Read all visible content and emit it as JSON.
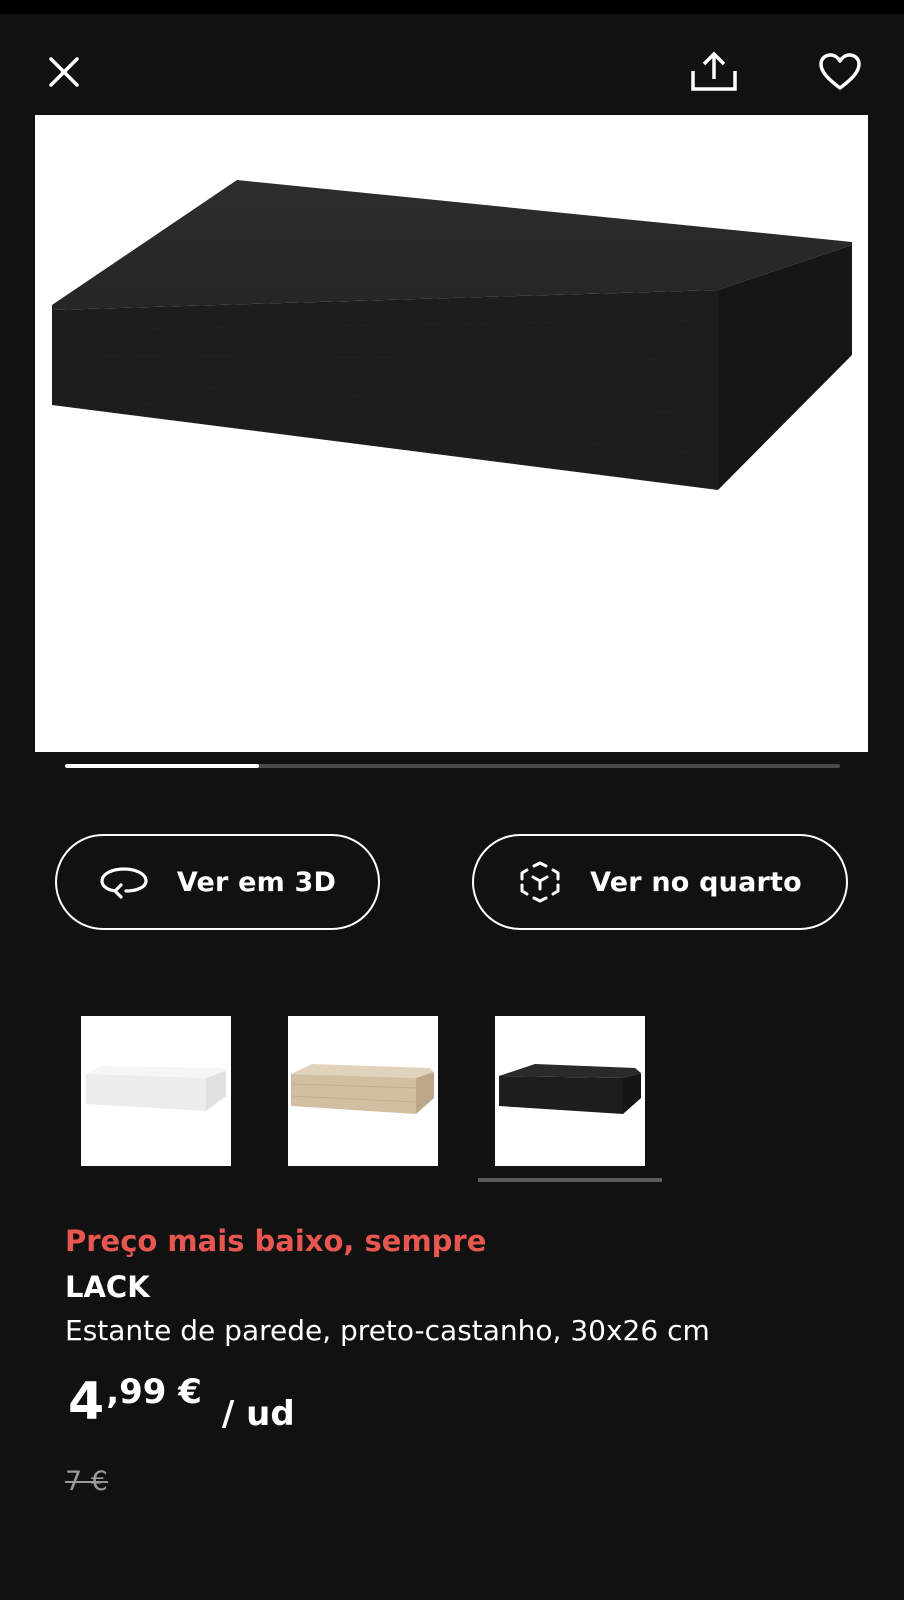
{
  "header": {
    "close_icon": "close-icon",
    "share_icon": "share-icon",
    "favorite_icon": "heart-icon"
  },
  "gallery": {
    "progress_fraction": 0.25,
    "image_alt": "LACK"
  },
  "actions": {
    "view_3d_label": "Ver em 3D",
    "view_room_label": "Ver no quarto"
  },
  "variants": [
    {
      "name": "white",
      "color": "#f2f2f2"
    },
    {
      "name": "oak",
      "color": "#d3bfa3"
    },
    {
      "name": "black-brown",
      "color": "#1e1e1e"
    }
  ],
  "product": {
    "promo": "Preço mais baixo, sempre",
    "name": "LACK",
    "description": "Estante de parede, preto-castanho, 30x26 cm",
    "price_integer": "4",
    "price_decimal": ",99 €",
    "price_unit": "/ ud",
    "old_price": "7 €"
  },
  "colors": {
    "background": "#111111",
    "promo": "#e8574f",
    "accent": "#ffffff"
  }
}
